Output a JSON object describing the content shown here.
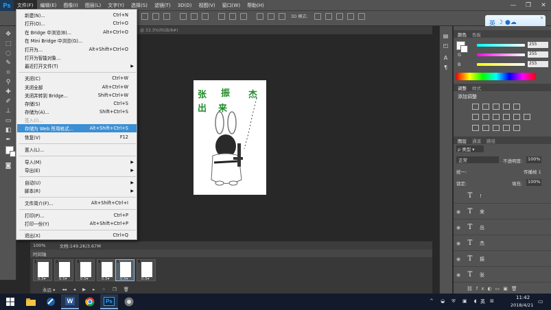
{
  "app": {
    "logo": "Ps"
  },
  "menubar": {
    "items": [
      "文件(F)",
      "编辑(E)",
      "图像(I)",
      "图层(L)",
      "文字(Y)",
      "选择(S)",
      "滤镜(T)",
      "3D(D)",
      "视图(V)",
      "窗口(W)",
      "帮助(H)"
    ],
    "window_controls": [
      "—",
      "❐",
      "✕"
    ]
  },
  "options_bar": {
    "mode_3d": "3D 模式:"
  },
  "ime": {
    "label": "英",
    "glyphs": "☽ ●☁"
  },
  "document": {
    "tab_title": "@ 33.3%(RGB/8#)",
    "zoom": "100%",
    "doc_size": "文档:149.2K/3.67M",
    "canvas_text": [
      "张",
      "振",
      "杰",
      "出",
      "来"
    ]
  },
  "file_menu": {
    "items": [
      {
        "label": "新建(N)...",
        "shortcut": "Ctrl+N"
      },
      {
        "label": "打开(O)...",
        "shortcut": "Ctrl+O"
      },
      {
        "label": "在 Bridge 中浏览(B)...",
        "shortcut": "Alt+Ctrl+O"
      },
      {
        "label": "在 Mini Bridge 中浏览(G)...",
        "shortcut": ""
      },
      {
        "label": "打开为...",
        "shortcut": "Alt+Shift+Ctrl+O"
      },
      {
        "label": "打开为智能对象...",
        "shortcut": ""
      },
      {
        "label": "最近打开文件(T)",
        "shortcut": ""
      },
      {
        "label": "关闭(C)",
        "shortcut": "Ctrl+W"
      },
      {
        "label": "关闭全部",
        "shortcut": "Alt+Ctrl+W"
      },
      {
        "label": "关闭并转到 Bridge...",
        "shortcut": "Shift+Ctrl+W"
      },
      {
        "label": "存储(S)",
        "shortcut": "Ctrl+S"
      },
      {
        "label": "存储为(A)...",
        "shortcut": "Shift+Ctrl+S"
      },
      {
        "label": "签入(I)...",
        "shortcut": ""
      },
      {
        "label": "存储为 Web 所用格式...",
        "shortcut": "Alt+Shift+Ctrl+S"
      },
      {
        "label": "恢复(V)",
        "shortcut": "F12"
      },
      {
        "label": "置入(L)...",
        "shortcut": ""
      },
      {
        "label": "导入(M)",
        "shortcut": ""
      },
      {
        "label": "导出(E)",
        "shortcut": ""
      },
      {
        "label": "自动(U)",
        "shortcut": ""
      },
      {
        "label": "脚本(R)",
        "shortcut": ""
      },
      {
        "label": "文件简介(F)...",
        "shortcut": "Alt+Shift+Ctrl+I"
      },
      {
        "label": "打印(P)...",
        "shortcut": "Ctrl+P"
      },
      {
        "label": "打印一份(Y)",
        "shortcut": "Alt+Shift+Ctrl+P"
      },
      {
        "label": "退出(X)",
        "shortcut": "Ctrl+Q"
      }
    ]
  },
  "timeline": {
    "title": "时间轴",
    "frames": [
      {
        "num": "1",
        "delay": "0.5▾"
      },
      {
        "num": "2",
        "delay": "0.5▾"
      },
      {
        "num": "3",
        "delay": "0.5▾"
      },
      {
        "num": "4",
        "delay": "0.5▾"
      },
      {
        "num": "5",
        "delay": "0.5▾"
      },
      {
        "num": "6",
        "delay": "0.5▾"
      }
    ],
    "loop": "永远 ▾"
  },
  "color_panel": {
    "tabs": [
      "颜色",
      "色板"
    ],
    "channels": [
      {
        "name": "R",
        "value": "255"
      },
      {
        "name": "G",
        "value": "255"
      },
      {
        "name": "B",
        "value": "255"
      }
    ]
  },
  "adjust_panel": {
    "tabs": [
      "调整",
      "样式"
    ],
    "title": "添加调整"
  },
  "layers_panel": {
    "tabs": [
      "图层",
      "通道",
      "路径"
    ],
    "kind": "ρ 类型 ▾",
    "blend_mode": "正常",
    "opacity_label": "不透明度:",
    "opacity_value": "100%",
    "lock_label": "锁定:",
    "fill_label": "填充:",
    "fill_value": "100%",
    "unify_label": "统一:",
    "propagate_label": "传播帧 1",
    "layers": [
      {
        "icon": "T",
        "name": "!"
      },
      {
        "icon": "T",
        "name": "来"
      },
      {
        "icon": "T",
        "name": "出"
      },
      {
        "icon": "T",
        "name": "杰"
      },
      {
        "icon": "T",
        "name": "振"
      },
      {
        "icon": "T",
        "name": "张"
      }
    ]
  },
  "taskbar": {
    "time": "11:42",
    "date": "2018/4/21",
    "lang": "英",
    "apps": [
      "W",
      "Ps"
    ]
  }
}
